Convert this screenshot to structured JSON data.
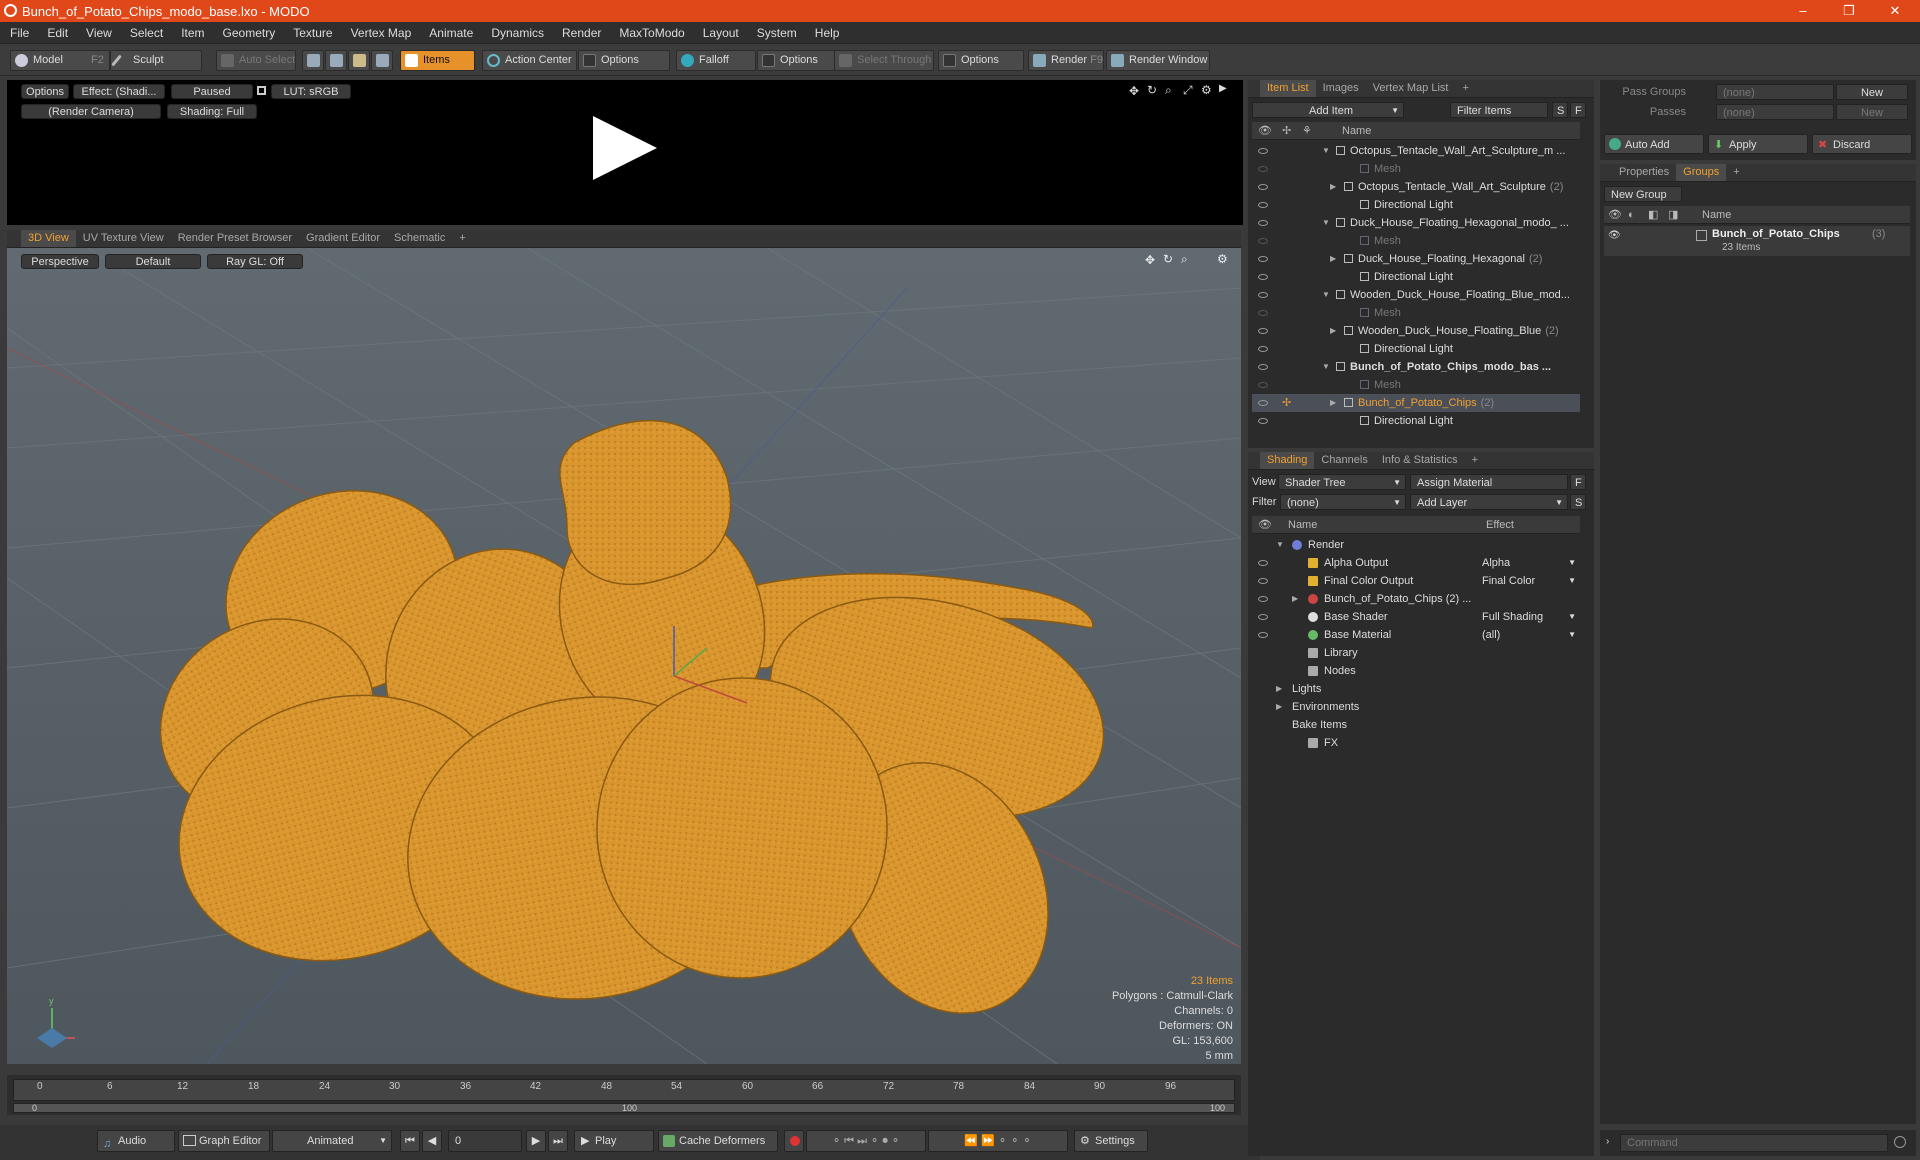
{
  "window": {
    "title": "Bunch_of_Potato_Chips_modo_base.lxo - MODO",
    "min": "–",
    "max": "❐",
    "close": "✕"
  },
  "menu": [
    "File",
    "Edit",
    "View",
    "Select",
    "Item",
    "Geometry",
    "Texture",
    "Vertex Map",
    "Animate",
    "Dynamics",
    "Render",
    "MaxToModo",
    "Layout",
    "System",
    "Help"
  ],
  "toolbar": {
    "model": "Model",
    "model_key": "F2",
    "sculpt": "Sculpt",
    "auto_select": "Auto Select",
    "items": "Items",
    "action_center": "Action Center",
    "options1": "Options",
    "falloff": "Falloff",
    "options2": "Options",
    "select_through": "Select Through",
    "options3": "Options",
    "render": "Render",
    "render_key": "F9",
    "render_window": "Render Window"
  },
  "preview": {
    "options": "Options",
    "effect": "Effect: (Shadi...",
    "paused": "Paused",
    "lut": "LUT: sRGB",
    "camera": "(Render Camera)",
    "shading": "Shading: Full"
  },
  "viewport_tabs": [
    "3D View",
    "UV Texture View",
    "Render Preset Browser",
    "Gradient Editor",
    "Schematic"
  ],
  "viewport": {
    "projection": "Perspective",
    "style": "Default",
    "raygl": "Ray GL: Off",
    "stats": {
      "items": "23 Items",
      "polygons": "Polygons : Catmull-Clark",
      "channels": "Channels: 0",
      "deformers": "Deformers: ON",
      "gl": "GL: 153,600",
      "scale": "5 mm"
    }
  },
  "timeline": {
    "ticks": [
      "0",
      "6",
      "12",
      "18",
      "24",
      "30",
      "36",
      "42",
      "48",
      "54",
      "60",
      "66",
      "72",
      "78",
      "84",
      "90",
      "96"
    ],
    "lower": [
      "0",
      "100",
      "100"
    ]
  },
  "transport": {
    "audio": "Audio",
    "graph_editor": "Graph Editor",
    "animated": "Animated",
    "frame": "0",
    "play": "Play",
    "cache": "Cache Deformers",
    "settings": "Settings"
  },
  "item_list": {
    "tabs": [
      "Item List",
      "Images",
      "Vertex Map List"
    ],
    "add_item": "Add Item",
    "filter_items": "Filter Items",
    "s": "S",
    "f": "F",
    "col_name": "Name",
    "rows": [
      {
        "label": "Octopus_Tentacle_Wall_Art_Sculpture_m ...",
        "indent": 0,
        "kind": "scene",
        "bold": false
      },
      {
        "label": "Mesh",
        "indent": 2,
        "kind": "mesh",
        "bold": false
      },
      {
        "label": "Octopus_Tentacle_Wall_Art_Sculpture",
        "count": "(2)",
        "indent": 1,
        "kind": "group",
        "bold": false
      },
      {
        "label": "Directional Light",
        "indent": 2,
        "kind": "light",
        "bold": false
      },
      {
        "label": "Duck_House_Floating_Hexagonal_modo_ ...",
        "indent": 0,
        "kind": "scene",
        "bold": false
      },
      {
        "label": "Mesh",
        "indent": 2,
        "kind": "mesh",
        "bold": false
      },
      {
        "label": "Duck_House_Floating_Hexagonal",
        "count": "(2)",
        "indent": 1,
        "kind": "group",
        "bold": false
      },
      {
        "label": "Directional Light",
        "indent": 2,
        "kind": "light",
        "bold": false
      },
      {
        "label": "Wooden_Duck_House_Floating_Blue_mod...",
        "indent": 0,
        "kind": "scene",
        "bold": false
      },
      {
        "label": "Mesh",
        "indent": 2,
        "kind": "mesh",
        "bold": false
      },
      {
        "label": "Wooden_Duck_House_Floating_Blue",
        "count": "(2)",
        "indent": 1,
        "kind": "group",
        "bold": false
      },
      {
        "label": "Directional Light",
        "indent": 2,
        "kind": "light",
        "bold": false
      },
      {
        "label": "Bunch_of_Potato_Chips_modo_bas ...",
        "indent": 0,
        "kind": "scene",
        "bold": true
      },
      {
        "label": "Mesh",
        "indent": 2,
        "kind": "mesh",
        "bold": false
      },
      {
        "label": "Bunch_of_Potato_Chips",
        "count": "(2)",
        "indent": 1,
        "kind": "group",
        "bold": false,
        "selected": true
      },
      {
        "label": "Directional Light",
        "indent": 2,
        "kind": "light",
        "bold": false
      }
    ]
  },
  "shading": {
    "tabs": [
      "Shading",
      "Channels",
      "Info & Statistics"
    ],
    "view_label": "View",
    "view_value": "Shader Tree",
    "assign_material": "Assign Material",
    "f": "F",
    "filter_label": "Filter",
    "filter_value": "(none)",
    "add_layer": "Add Layer",
    "s": "S",
    "col_name": "Name",
    "col_effect": "Effect",
    "rows": [
      {
        "label": "Render",
        "effect": "",
        "indent": 0,
        "eye": false
      },
      {
        "label": "Alpha Output",
        "effect": "Alpha",
        "indent": 1,
        "eye": true
      },
      {
        "label": "Final Color Output",
        "effect": "Final Color",
        "indent": 1,
        "eye": true
      },
      {
        "label": "Bunch_of_Potato_Chips (2) ...",
        "effect": "",
        "indent": 1,
        "eye": true
      },
      {
        "label": "Base Shader",
        "effect": "Full Shading",
        "indent": 1,
        "eye": true
      },
      {
        "label": "Base Material",
        "effect": "(all)",
        "indent": 1,
        "eye": true
      },
      {
        "label": "Library",
        "effect": "",
        "indent": 1,
        "eye": false
      },
      {
        "label": "Nodes",
        "effect": "",
        "indent": 1,
        "eye": false
      },
      {
        "label": "Lights",
        "effect": "",
        "indent": 0,
        "eye": false
      },
      {
        "label": "Environments",
        "effect": "",
        "indent": 0,
        "eye": false
      },
      {
        "label": "Bake Items",
        "effect": "",
        "indent": 0,
        "eye": false
      },
      {
        "label": "FX",
        "effect": "",
        "indent": 1,
        "eye": false
      }
    ]
  },
  "pass": {
    "pass_groups": "Pass Groups",
    "passes": "Passes",
    "none": "(none)",
    "new": "New",
    "auto_add": "Auto Add",
    "apply": "Apply",
    "discard": "Discard"
  },
  "groups": {
    "tabs": [
      "Properties",
      "Groups"
    ],
    "new_group": "New Group",
    "col_name": "Name",
    "group_name": "Bunch_of_Potato_Chips",
    "group_count": "(3)",
    "group_items": "23 Items"
  },
  "command": {
    "placeholder": "Command"
  },
  "colors": {
    "accent": "#e0481a",
    "highlight": "#f0a030",
    "chip": "#d9962e"
  }
}
